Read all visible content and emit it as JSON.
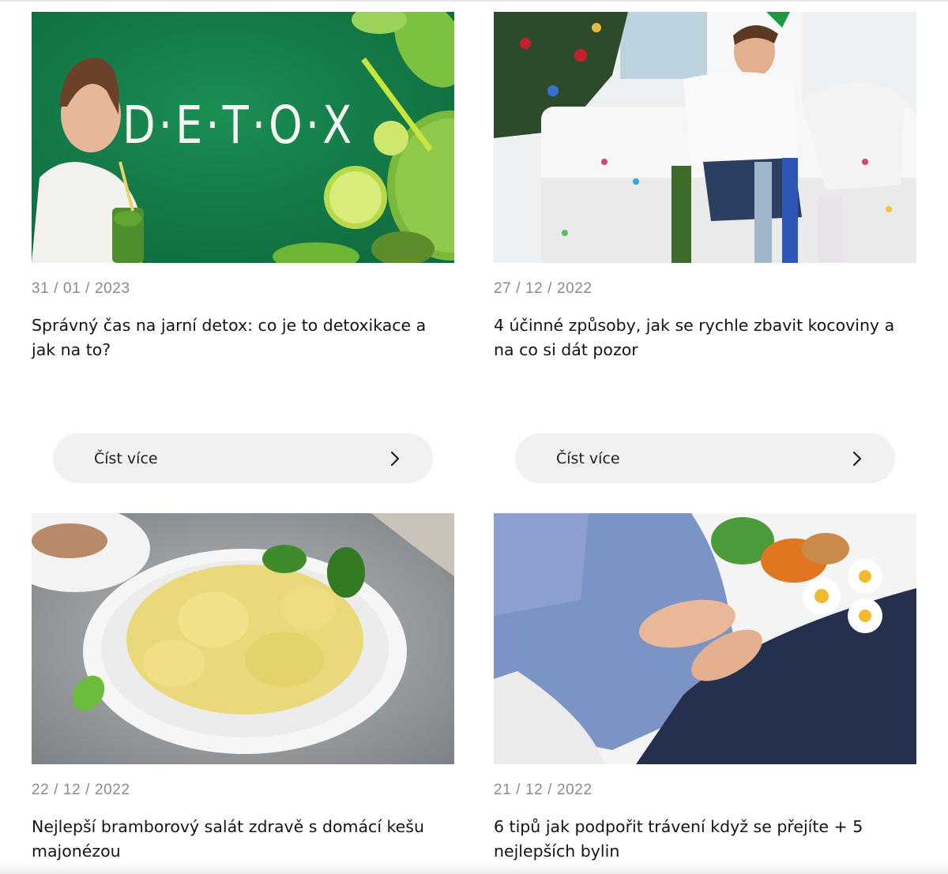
{
  "articles": [
    {
      "date": "31 / 01 / 2023",
      "title": "Správný čas na jarní detox: co je to detoxikace a jak na to?",
      "image_text": "D·E·T·O·X",
      "read_more": "Číst více"
    },
    {
      "date": "27 / 12 / 2022",
      "title": "4 účinné způsoby, jak se rychle zbavit kocoviny a na co si dát pozor",
      "read_more": "Číst více"
    },
    {
      "date": "22 / 12 / 2022",
      "title": "Nejlepší bramborový salát zdravě s domácí kešu majonézou"
    },
    {
      "date": "21 / 12 / 2022",
      "title": "6 tipů jak podpořit trávení když se přejíte + 5 nejlepších bylin"
    }
  ],
  "icons": {
    "read_more_arrow": "chevron-right-icon"
  },
  "colors": {
    "button_bg": "#f1f1f1",
    "date_text": "#8a8a8a",
    "detox_green": "#16814c"
  }
}
